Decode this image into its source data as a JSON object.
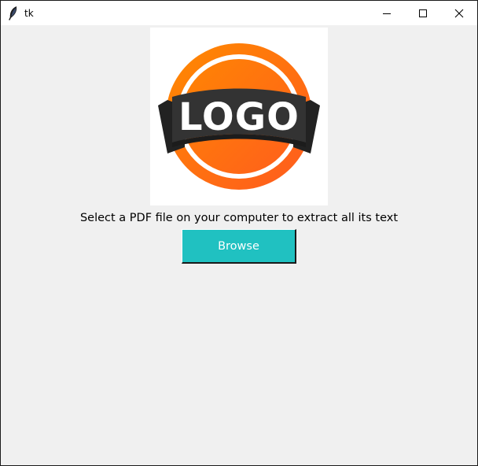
{
  "window": {
    "title": "tk",
    "app_icon": "feather-icon",
    "controls": {
      "minimize_icon": "minimize-icon",
      "maximize_icon": "maximize-icon",
      "close_icon": "close-icon"
    }
  },
  "logo": {
    "text": "LOGO",
    "colors": {
      "orange": "#ff7a00",
      "ribbon": "#2e2e2e"
    }
  },
  "main": {
    "instruction": "Select a PDF file on your computer to extract all its text",
    "browse_label": "Browse",
    "browse_color": "#20c1c1"
  }
}
